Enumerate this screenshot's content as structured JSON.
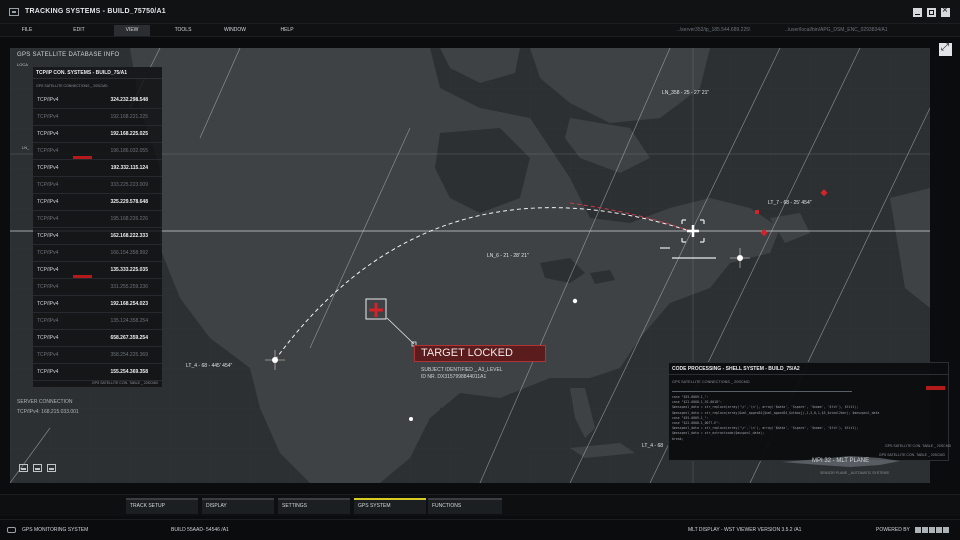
{
  "window": {
    "title": "TRACKING SYSTEMS - BUILD_75750/A1",
    "buttons": [
      "minimize",
      "maximize",
      "close"
    ]
  },
  "menu": {
    "items": [
      "FILE",
      "EDIT",
      "VIEW",
      "TOOLS",
      "WINDOW",
      "HELP"
    ],
    "active": "VIEW",
    "path_left": "../server352/ip_185.544.689.225\\",
    "path_right": "../user/local/bin/APG_DSM_ENC_0293834/A1"
  },
  "database": {
    "title": "GPS SATELLITE DATABASE INFO",
    "faded_top": "LOCA",
    "faded_side": "LN_"
  },
  "connections": {
    "title": "TCP/IP CON. SYSTEMS - BUILD_75/A1",
    "subtitle": "GPS SATELLITE CONNECTIONS _ 20SCMD",
    "footer": "GPS SATELLITE CON. TABLE _ 20SCMD",
    "rows": [
      {
        "proto": "TCP/IPv4",
        "ip": "324.232.298.548",
        "dim": false,
        "flag": false
      },
      {
        "proto": "TCP/IPv4",
        "ip": "192.168.221.225",
        "dim": true,
        "flag": false
      },
      {
        "proto": "TCP/IPv4",
        "ip": "192.168.225.025",
        "dim": false,
        "flag": false
      },
      {
        "proto": "TCP/IPv4",
        "ip": "196.186.032.055",
        "dim": true,
        "flag": true
      },
      {
        "proto": "TCP/IPv4",
        "ip": "192.332.115.124",
        "dim": false,
        "flag": false
      },
      {
        "proto": "TCP/IPv4",
        "ip": "333.225.223.009",
        "dim": true,
        "flag": false
      },
      {
        "proto": "TCP/IPv4",
        "ip": "325.229.578.648",
        "dim": false,
        "flag": false
      },
      {
        "proto": "TCP/IPv4",
        "ip": "195.168.226.226",
        "dim": true,
        "flag": false
      },
      {
        "proto": "TCP/IPv4",
        "ip": "162.168.222.333",
        "dim": false,
        "flag": false
      },
      {
        "proto": "TCP/IPv4",
        "ip": "166.154.358.992",
        "dim": true,
        "flag": false
      },
      {
        "proto": "TCP/IPv4",
        "ip": "135.333.225.035",
        "dim": false,
        "flag": true
      },
      {
        "proto": "TCP/IPv4",
        "ip": "331.255.259.236",
        "dim": true,
        "flag": false
      },
      {
        "proto": "TCP/IPv4",
        "ip": "192.168.254.023",
        "dim": false,
        "flag": false
      },
      {
        "proto": "TCP/IPv4",
        "ip": "135.124.358.254",
        "dim": true,
        "flag": false
      },
      {
        "proto": "TCP/IPv4",
        "ip": "658.267.359.254",
        "dim": false,
        "flag": false
      },
      {
        "proto": "TCP/IPv4",
        "ip": "358.254.225.369",
        "dim": true,
        "flag": false
      },
      {
        "proto": "TCP/IPv4",
        "ip": "155.254.369.358",
        "dim": false,
        "flag": false
      }
    ]
  },
  "server": {
    "label": "SERVER CONNECTION",
    "ip": "TCP/IPv4: 168.215.033.001"
  },
  "map": {
    "labels": [
      {
        "id": "ln358",
        "text": "LN_358 - 25 - 27' 21\""
      },
      {
        "id": "lt7",
        "text": "LT_7 - 68 - 25' 454\""
      },
      {
        "id": "ln6",
        "text": "LN_6 - 21 - 28' 21\""
      },
      {
        "id": "lt4",
        "text": "LT_4 - 68 - 445' 454\""
      },
      {
        "id": "lt4b",
        "text": "LT_4 - 68"
      }
    ],
    "target": {
      "status": "TARGET LOCKED",
      "line1": "SUBJECT IDENTIFIED _ A3_LEVEL",
      "line2": "ID NR. DX3157998844011A1"
    }
  },
  "code_panel": {
    "title": "CODE PROCESSING - SHELL SYSTEM - BUILD_75/A2",
    "subtitle": "GPS SATELLITE CONNECTIONS _ 20SCMD",
    "footer": "GPS SATELLITE CON. TABLE _ 20SCMD",
    "lines": [
      "case \"$55-0009-1_\":",
      "case \"$22-0008-1_SS-0018\":",
      "$mesxpexl_data = str_replace(array('\\r','\\n'), array('$data', '$spare', '$name', '$fit'), $fit1);",
      "$mesxpexl_data = str_replace(array($xml_appex84[$xml_appex84_$xtbox]),1,3,0,1,$5_$xtool2bar); $mesxpexl_data",
      "case \"$55-0009-1_\":",
      "case \"$22-0008-1_0077-E\":",
      "$mesxpexl_data = str_replace(array('\\r','\\n'), array('$data', '$spare', '$name', '$fit'), $fit1);",
      "$mesxpexl_data = str_extractcode($msxpexl_data);",
      "break;"
    ]
  },
  "plane": {
    "label": "MPI 32 - MLT PLANE",
    "sub": "SENSOR PLANE _ AUTOMATIC SYSTEMS",
    "side": "GPS SATELLITE CON. TABLE _ 20SCMD"
  },
  "tabs": [
    {
      "label": "TRACK SETUP",
      "active": false
    },
    {
      "label": "DISPLAY",
      "active": false
    },
    {
      "label": "SETTINGS",
      "active": false
    },
    {
      "label": "GPS SYSTEM",
      "active": true
    },
    {
      "label": "FUNCTIONS",
      "active": false
    }
  ],
  "status": {
    "left": "GPS MONITORING SYSTEM",
    "build": "BUILD 55AAD- 54546 /A1",
    "display": "MLT DISPLAY - WST VIEWER VERSION 3.5.2 /A1",
    "powered": "POWERED BY"
  },
  "colors": {
    "accent_red": "#b51a1a",
    "active_tab": "#d7cc26",
    "map_land": "#3f4245",
    "map_sea": "#2d3033"
  }
}
